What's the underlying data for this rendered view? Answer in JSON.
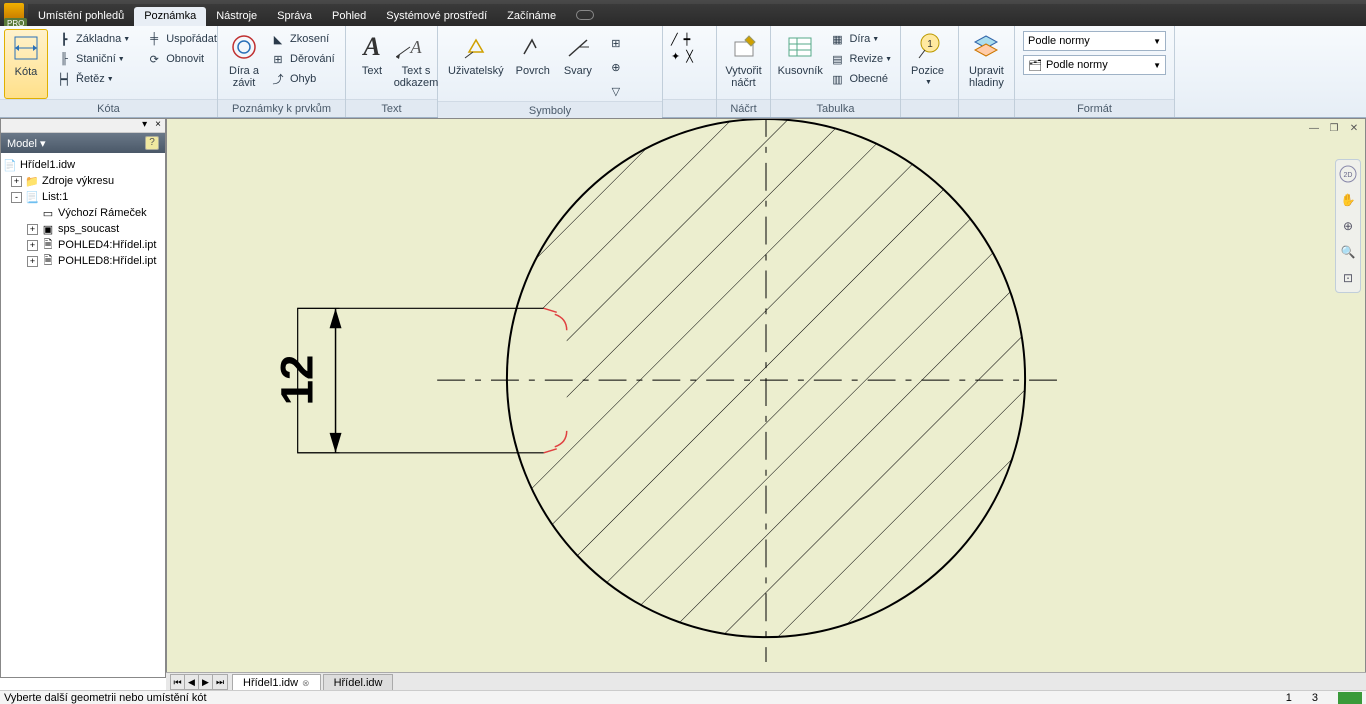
{
  "menu": {
    "tabs": [
      "Umístění pohledů",
      "Poznámka",
      "Nástroje",
      "Správa",
      "Pohled",
      "Systémové prostředí",
      "Začínáme"
    ],
    "active": 1
  },
  "ribbon": {
    "kota": {
      "big": "Kóta",
      "items": [
        "Základna",
        "Staniční",
        "Řetěz",
        "Uspořádat",
        "Obnovit"
      ],
      "title": "Kóta"
    },
    "prvky": {
      "big": "Díra a\nzávit",
      "items": [
        "Zkosení",
        "Děrování",
        "Ohyb"
      ],
      "title": "Poznámky k prvkům"
    },
    "text": {
      "big1": "Text",
      "big2": "Text s\nodkazem",
      "title": "Text"
    },
    "symboly": {
      "items": [
        "Uživatelský",
        "Povrch",
        "Svary"
      ],
      "title": "Symboly"
    },
    "nacrt": {
      "big": "Vytvořit\nnáčrt",
      "title": "Náčrt"
    },
    "tabulka": {
      "big": "Kusovník",
      "items": [
        "Díra",
        "Revize",
        "Obecné"
      ],
      "title": "Tabulka"
    },
    "pozice": {
      "big": "Pozice"
    },
    "hladiny": {
      "big": "Upravit\nhladiny"
    },
    "format": {
      "dd1": "Podle normy",
      "dd2": "Podle normy",
      "title": "Formát"
    }
  },
  "browser": {
    "title": "Model",
    "root": "Hřídel1.idw",
    "nodes": [
      {
        "indent": 0,
        "exp": "+",
        "icon": "folder",
        "label": "Zdroje výkresu"
      },
      {
        "indent": 0,
        "exp": "-",
        "icon": "sheet",
        "label": "List:1"
      },
      {
        "indent": 1,
        "exp": "",
        "icon": "frame",
        "label": "Výchozí Rámeček"
      },
      {
        "indent": 1,
        "exp": "+",
        "icon": "block",
        "label": "sps_soucast"
      },
      {
        "indent": 1,
        "exp": "+",
        "icon": "view",
        "label": "POHLED4:Hřídel.ipt"
      },
      {
        "indent": 1,
        "exp": "+",
        "icon": "view",
        "label": "POHLED8:Hřídel.ipt"
      }
    ]
  },
  "drawing": {
    "dim_value": "12"
  },
  "doctabs": {
    "tabs": [
      {
        "label": "Hřídel1.idw",
        "close": true
      },
      {
        "label": "Hřídel.idw",
        "close": false
      }
    ]
  },
  "status": {
    "msg": "Vyberte další geometrii nebo umístění kót",
    "n1": "1",
    "n2": "3"
  }
}
